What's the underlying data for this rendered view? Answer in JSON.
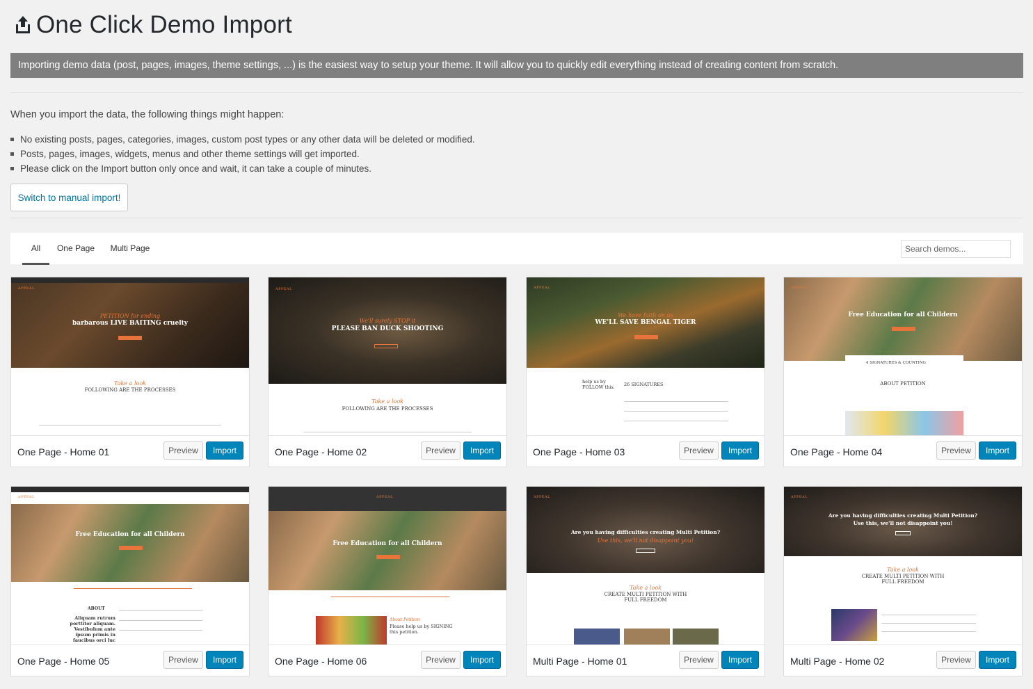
{
  "page": {
    "title": "One Click Demo Import",
    "icon": "upload-icon"
  },
  "intro": {
    "text": "Importing demo data (post, pages, images, theme settings, ...) is the easiest way to setup your theme. It will allow you to quickly edit everything instead of creating content from scratch."
  },
  "notice": {
    "heading": "When you import the data, the following things might happen:",
    "items": [
      "No existing posts, pages, categories, images, custom post types or any other data will be deleted or modified.",
      "Posts, pages, images, widgets, menus and other theme settings will get imported.",
      "Please click on the Import button only once and wait, it can take a couple of minutes."
    ]
  },
  "manual_import_label": "Switch to manual import!",
  "filters": {
    "tabs": [
      "All",
      "One Page",
      "Multi Page"
    ],
    "active": "All",
    "search_placeholder": "Search demos..."
  },
  "buttons": {
    "preview": "Preview",
    "import": "Import"
  },
  "demos": [
    {
      "name": "One Page - Home 01",
      "hero_italic": "PETITION for ending",
      "hero_title": "barbarous LIVE BAITING cruelty",
      "section_italic": "Take a look",
      "section_heading": "FOLLOWING ARE THE PROCESSES"
    },
    {
      "name": "One Page - Home 02",
      "hero_italic": "We'll surely STOP it",
      "hero_title": "PLEASE BAN DUCK SHOOTING",
      "section_italic": "Take a look",
      "section_heading": "FOLLOWING ARE THE PROCESSES"
    },
    {
      "name": "One Page - Home 03",
      "hero_italic": "We have faith on us",
      "hero_title": "WE'LL SAVE BENGAL TIGER",
      "section_italic": "help us by FOLLOW this.",
      "section_heading": "26 SIGNATURES"
    },
    {
      "name": "One Page - Home 04",
      "hero_italic": "",
      "hero_title": "Free Education for all Childern",
      "section_italic": "4 SIGNATURES & COUNTING",
      "section_heading": "ABOUT PETITION"
    },
    {
      "name": "One Page - Home 05",
      "hero_italic": "",
      "hero_title": "Free Education for all Childern",
      "section_italic": "ABOUT",
      "section_heading": "Aliquam rutrum porttitor aliquam. Vestibulum ante ipsum primis in faucibus orci luc"
    },
    {
      "name": "One Page - Home 06",
      "hero_italic": "",
      "hero_title": "Free Education for all Childern",
      "section_italic": "About Petition",
      "section_heading": "Please help us by SIGNING this petition."
    },
    {
      "name": "Multi Page - Home 01",
      "hero_italic": "Use this, we'll not disappoint you!",
      "hero_title": "Are you having difficulties creating Multi Petition?",
      "section_italic": "Take a look",
      "section_heading": "CREATE MULTI PETITION WITH FULL FREEDOM"
    },
    {
      "name": "Multi Page - Home 02",
      "hero_italic": "Use this, we'll not disappoint you!",
      "hero_title": "Are you having difficulties creating Multi Petition?",
      "section_italic": "Take a look",
      "section_heading": "CREATE MULTI PETITION WITH FULL FREEDOM"
    }
  ],
  "colors": {
    "accent_orange": "#e8743b",
    "import_blue": "#0085ba",
    "link_blue": "#0073aa",
    "banner_gray": "#7f7f7f"
  }
}
